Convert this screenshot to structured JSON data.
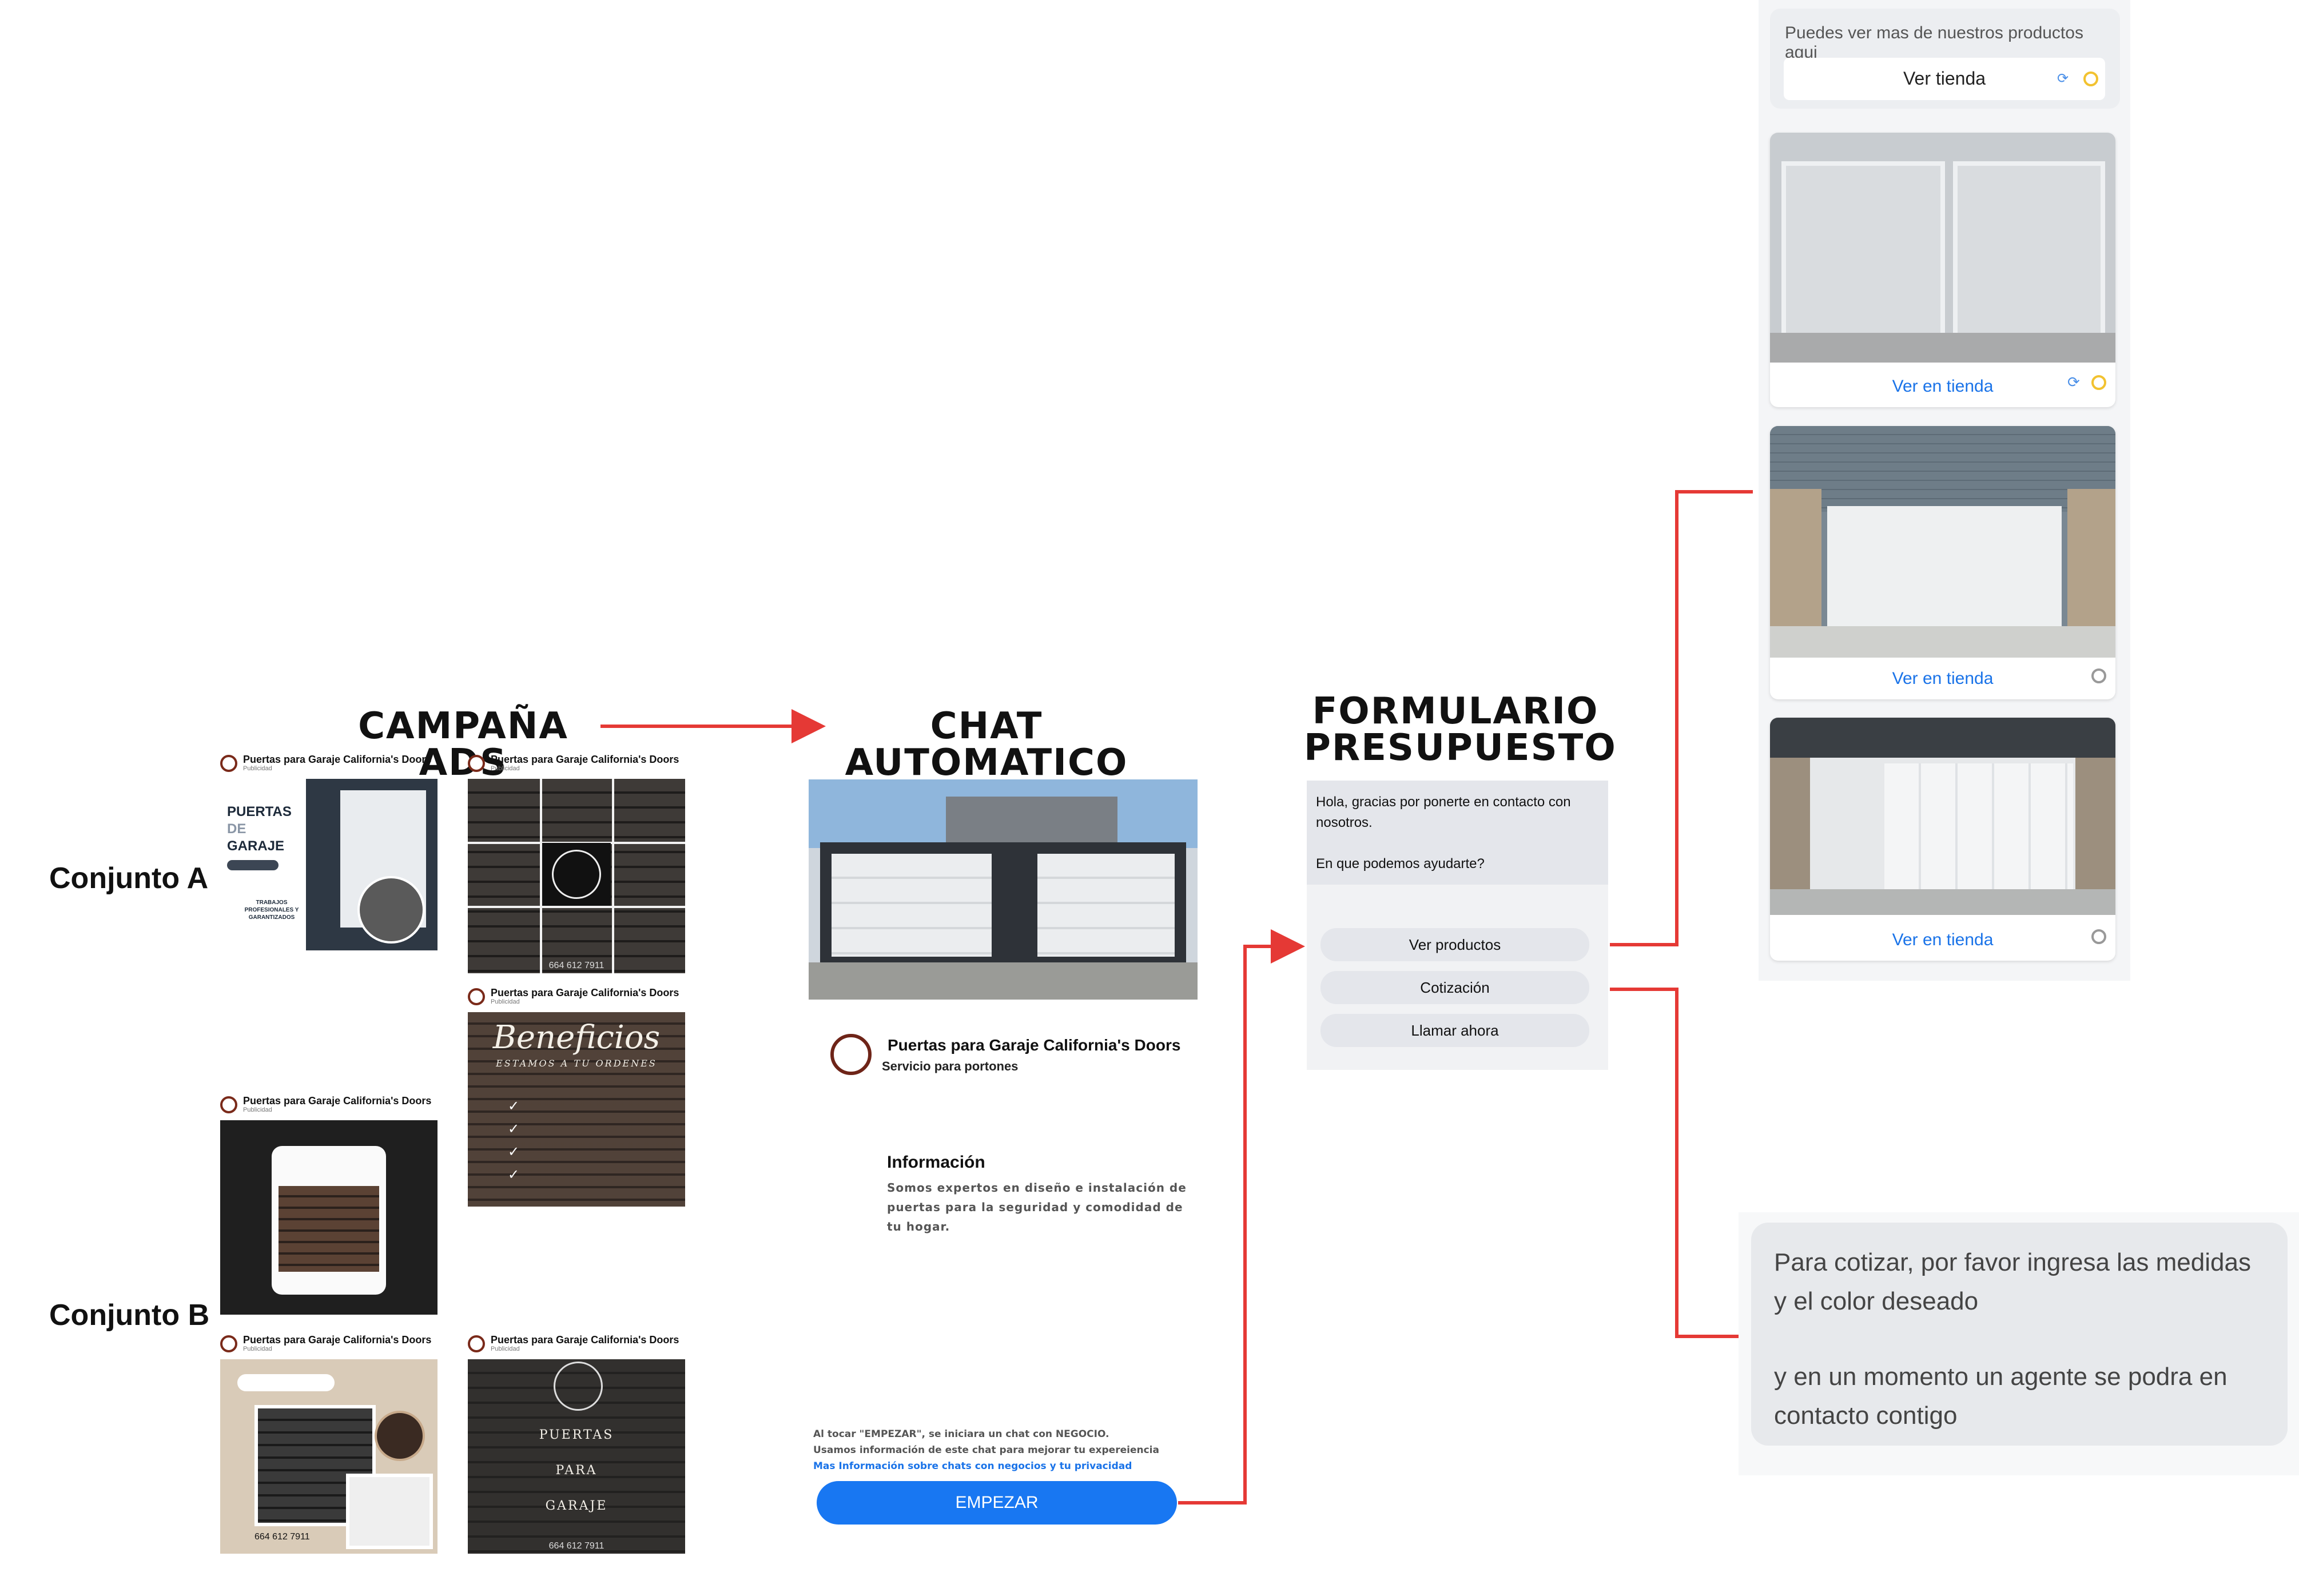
{
  "titles": {
    "campaign": "CAMPAÑA ADS",
    "chat": "CHAT AUTOMATICO",
    "form_line1": "FORMULARIO",
    "form_line2": "PRESUPUESTO"
  },
  "sets": {
    "a": "Conjunto A",
    "b": "Conjunto B"
  },
  "ad": {
    "page_name": "Puertas para Garaje California's Doors",
    "sponsored": "Publicidad"
  },
  "ads": {
    "a1": {
      "headline_1": "PUERTAS",
      "headline_2": "DE",
      "headline_3": "GARAJE",
      "sub": "TRABAJOS PROFESIONALES Y GARANTIZADOS"
    },
    "a2": {
      "phone": "664 612 7911"
    },
    "beneficios": {
      "title": "Beneficios",
      "subtitle": "ESTAMOS A TU ORDENES"
    },
    "b2": {
      "phone": "664 612 7911"
    },
    "b3": {
      "line1": "PUERTAS",
      "line2": "PARA",
      "line3": "GARAJE",
      "phone": "664 612 7911"
    }
  },
  "chat": {
    "biz_name": "Puertas para Garaje California's Doors",
    "biz_sub": "Servicio para portones",
    "info_title": "Información",
    "info_text_1": "Somos expertos en diseño e instalación de",
    "info_text_2": "puertas para la seguridad y comodidad de",
    "info_text_3": "tu hogar.",
    "disclaimer_1": "Al tocar \"EMPEZAR\", se iniciara un chat con NEGOCIO.",
    "disclaimer_2": "Usamos información de este chat para mejorar tu expereiencia",
    "disclaimer_link": "Mas Información sobre chats con negocios y tu privacidad",
    "cta": "EMPEZAR"
  },
  "form": {
    "greeting_1": "Hola, gracias por ponerte en contacto con",
    "greeting_2": "nosotros.",
    "question": "En que podemos ayudarte?",
    "options": [
      "Ver productos",
      "Cotización",
      "Llamar ahora"
    ]
  },
  "catalog": {
    "header_text": "Puedes ver mas de nuestros productos aqui",
    "store_button": "Ver tienda",
    "card_link": "Ver en tienda"
  },
  "quote": {
    "line1": "Para cotizar, por favor ingresa las medidas",
    "line2": "y el color deseado",
    "line3": "y en un momento un agente se podra en",
    "line4": "contacto contigo"
  },
  "colors": {
    "arrow": "#e53935",
    "messenger_blue": "#1877f2",
    "link_blue": "#1a73e8"
  }
}
